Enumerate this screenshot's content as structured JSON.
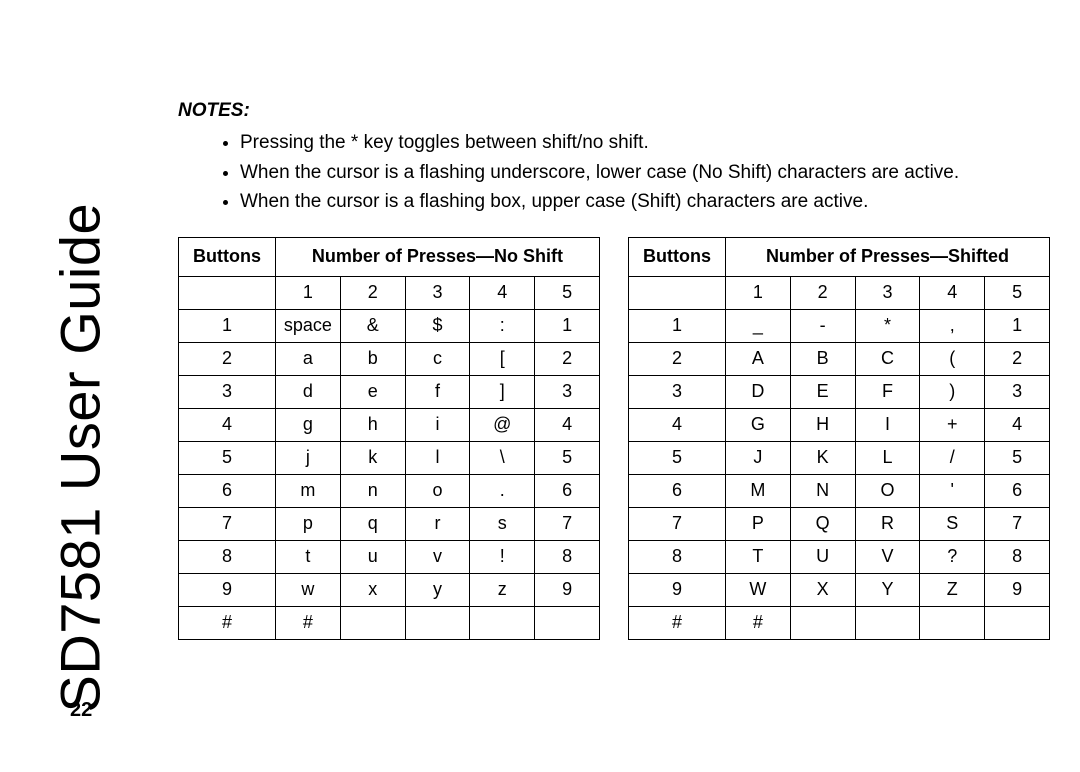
{
  "sidebar_title": "SD7581 User Guide",
  "notes_heading": "NOTES:",
  "notes": [
    "Pressing the * key toggles between shift/no shift.",
    "When the cursor is a flashing underscore, lower case (No Shift) characters are active.",
    "When the cursor is a flashing box, upper case (Shift) characters are active."
  ],
  "page_number": "22",
  "table_left": {
    "head_buttons": "Buttons",
    "head_presses": "Number of Presses—No Shift",
    "sub": [
      "1",
      "2",
      "3",
      "4",
      "5"
    ],
    "rows": [
      [
        "1",
        "space",
        "&",
        "$",
        ":",
        "1"
      ],
      [
        "2",
        "a",
        "b",
        "c",
        "[",
        "2"
      ],
      [
        "3",
        "d",
        "e",
        "f",
        "]",
        "3"
      ],
      [
        "4",
        "g",
        "h",
        "i",
        "@",
        "4"
      ],
      [
        "5",
        "j",
        "k",
        "l",
        "\\",
        "5"
      ],
      [
        "6",
        "m",
        "n",
        "o",
        ".",
        "6"
      ],
      [
        "7",
        "p",
        "q",
        "r",
        "s",
        "7"
      ],
      [
        "8",
        "t",
        "u",
        "v",
        "!",
        "8"
      ],
      [
        "9",
        "w",
        "x",
        "y",
        "z",
        "9"
      ],
      [
        "#",
        "#",
        "",
        "",
        "",
        ""
      ]
    ]
  },
  "table_right": {
    "head_buttons": "Buttons",
    "head_presses": "Number of Presses—Shifted",
    "sub": [
      "1",
      "2",
      "3",
      "4",
      "5"
    ],
    "rows": [
      [
        "1",
        "_",
        "-",
        "*",
        ",",
        "1"
      ],
      [
        "2",
        "A",
        "B",
        "C",
        "(",
        "2"
      ],
      [
        "3",
        "D",
        "E",
        "F",
        ")",
        "3"
      ],
      [
        "4",
        "G",
        "H",
        "I",
        "+",
        "4"
      ],
      [
        "5",
        "J",
        "K",
        "L",
        "/",
        "5"
      ],
      [
        "6",
        "M",
        "N",
        "O",
        "'",
        "6"
      ],
      [
        "7",
        "P",
        "Q",
        "R",
        "S",
        "7"
      ],
      [
        "8",
        "T",
        "U",
        "V",
        "?",
        "8"
      ],
      [
        "9",
        "W",
        "X",
        "Y",
        "Z",
        "9"
      ],
      [
        "#",
        "#",
        "",
        "",
        "",
        ""
      ]
    ]
  }
}
